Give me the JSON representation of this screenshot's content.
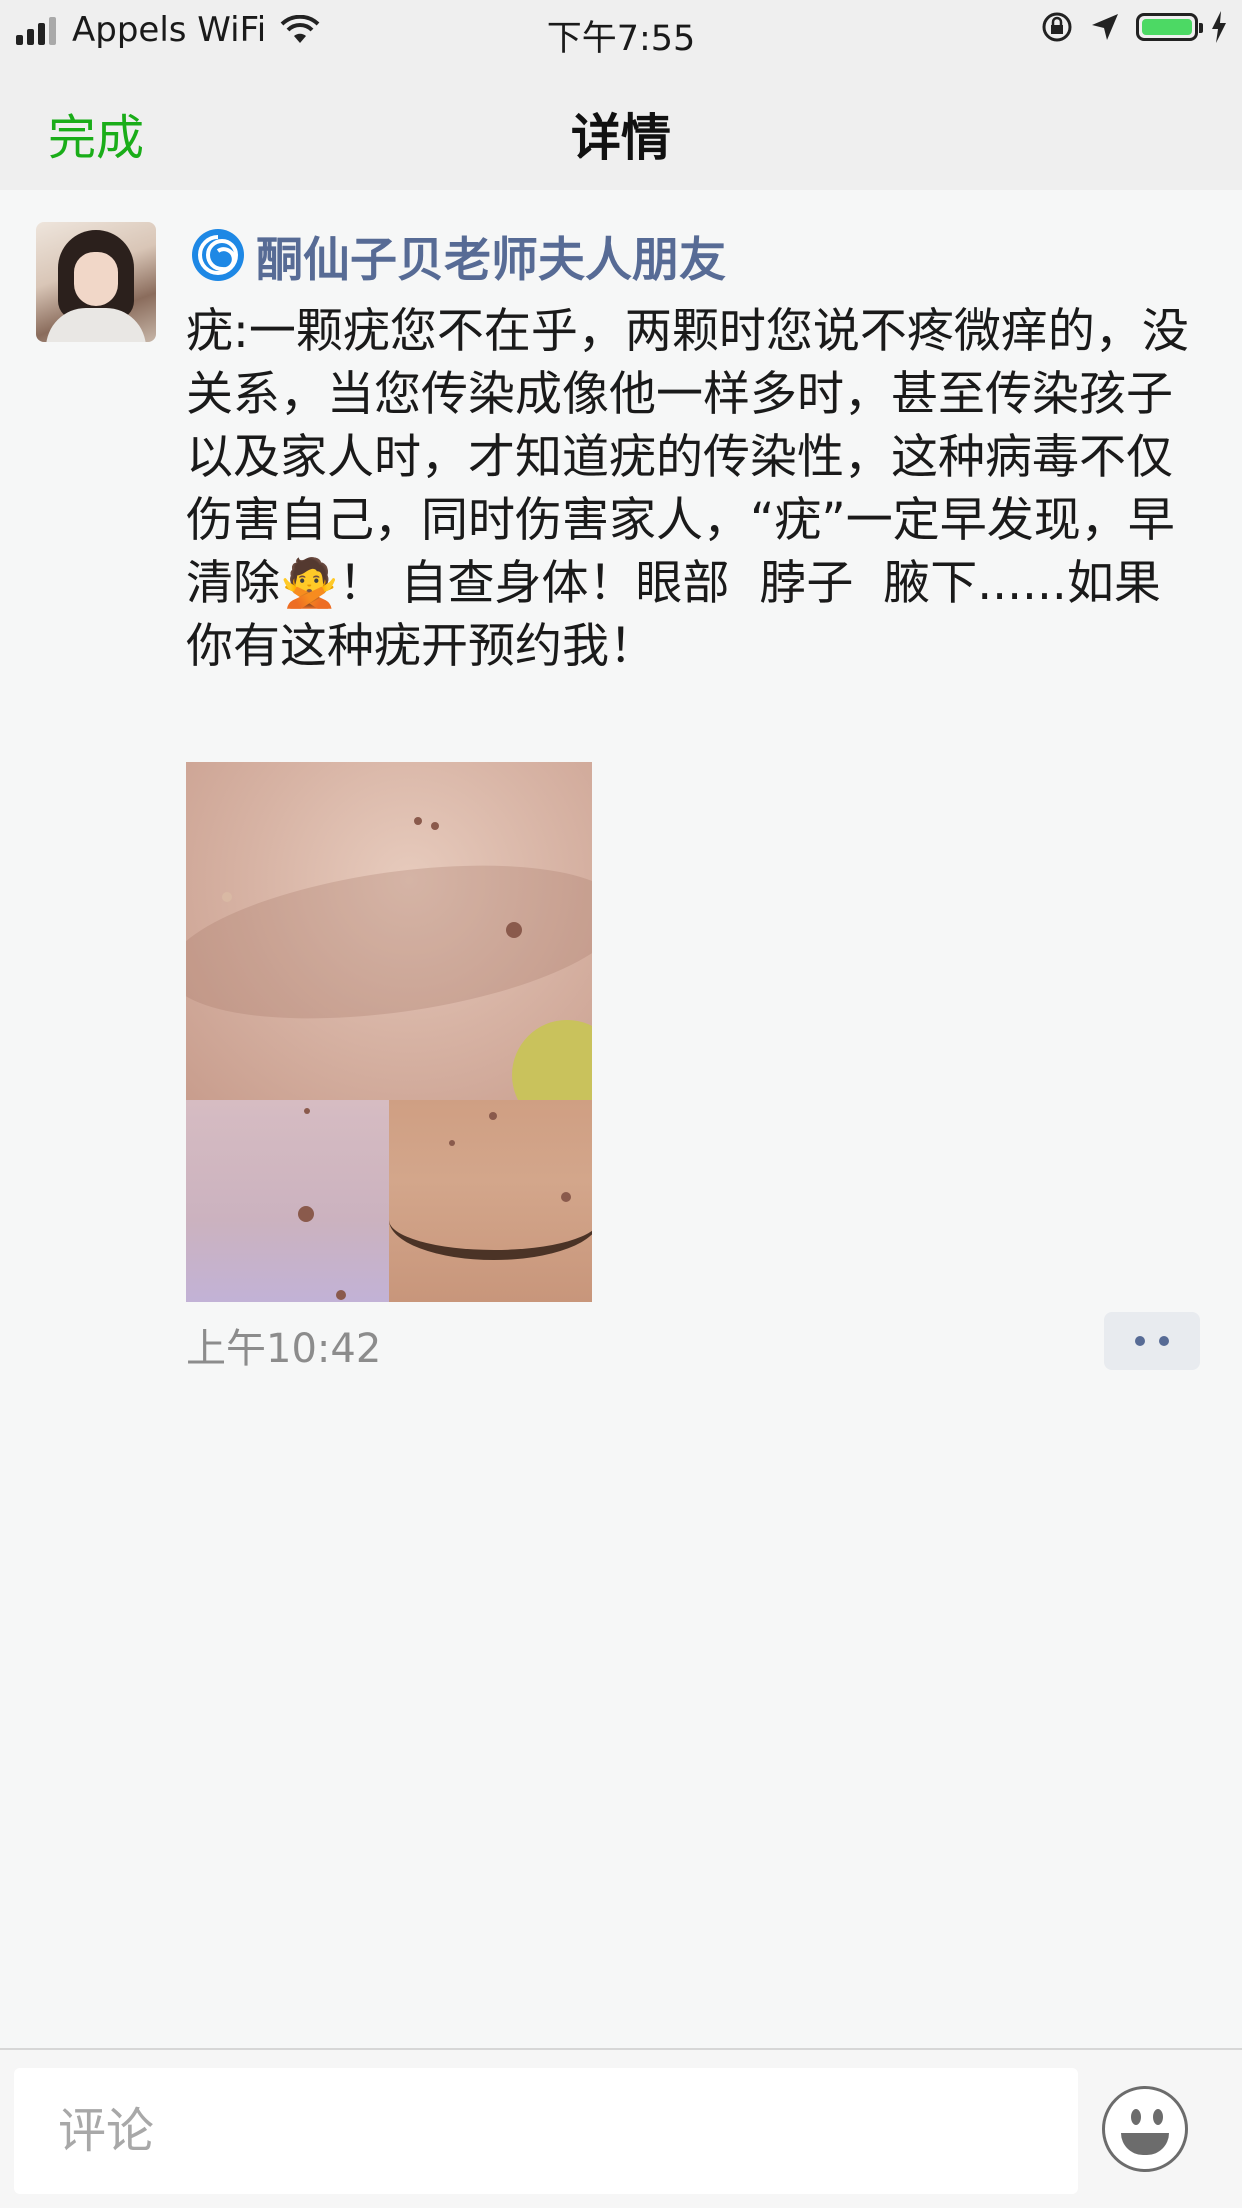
{
  "status_bar": {
    "carrier": "Appels WiFi",
    "time": "下午7:55"
  },
  "nav": {
    "done_label": "完成",
    "title": "详情"
  },
  "post": {
    "author": "酮仙子贝老师夫人朋友",
    "text": "疣:一颗疣您不在乎，两颗时您说不疼微痒的，没关系，当您传染成像他一样多时，甚至传染孩子以及家人时，才知道疣的传染性，这种病毒不仅伤害自己，同时伤害家人，“疣”一定早发现，早清除🙅！ 自查身体！眼部  脖子  腋下......如果你有这种疣开预约我！",
    "timestamp": "上午10:42"
  },
  "comment_bar": {
    "placeholder": "评论"
  },
  "colors": {
    "accent_green": "#1aad19",
    "link_blue": "#576b95",
    "battery_green": "#4cd964"
  },
  "icons": {
    "author_badge": "swirl-icon",
    "more": "more-dots-icon",
    "emoji": "smiley-icon"
  }
}
